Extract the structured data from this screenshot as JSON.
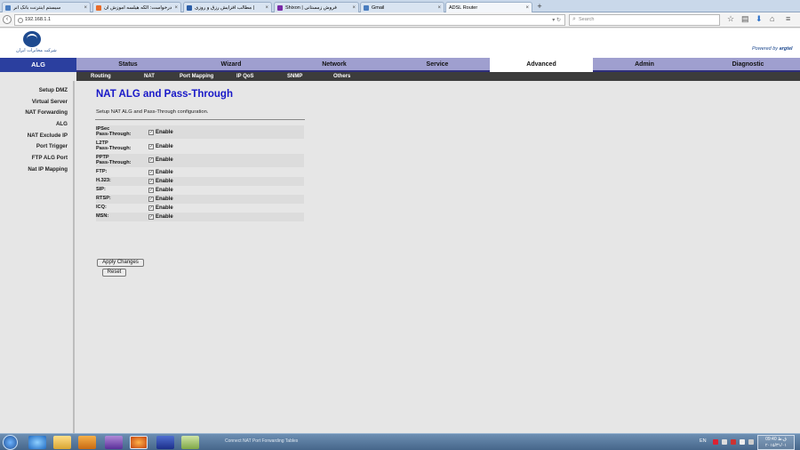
{
  "browser": {
    "tabs": [
      {
        "title": "سیستم اینترنت بانک آنر",
        "color": "#4a7dbf",
        "active": false
      },
      {
        "title": "درخواست: الکه هیلسه آموزش ان",
        "color": "#e86b2a",
        "active": false
      },
      {
        "title": "مطالب افزایش رزق و روزی |",
        "color": "#2b5ea8",
        "active": false
      },
      {
        "title": "Shixon | فروش زمستانی",
        "color": "#7a2aa8",
        "active": false
      },
      {
        "title": "Gmail",
        "color": "#4a7dbf",
        "active": false
      },
      {
        "title": "ADSL Router",
        "color": "#ffffff",
        "active": true
      }
    ],
    "new_tab": "+",
    "address": "192.168.1.1",
    "search_placeholder": "Search"
  },
  "router": {
    "logo_text": "شرکت مخابرات ایران",
    "powered_by": "Powered by",
    "powered_brand": "argtel",
    "section_header": "ALG",
    "main_menu": [
      {
        "label": "Status",
        "active": false
      },
      {
        "label": "Wizard",
        "active": false
      },
      {
        "label": "Network",
        "active": false
      },
      {
        "label": "Service",
        "active": false
      },
      {
        "label": "Advanced",
        "active": true
      },
      {
        "label": "Admin",
        "active": false
      },
      {
        "label": "Diagnostic",
        "active": false
      }
    ],
    "sub_menu": [
      "Routing",
      "NAT",
      "Port Mapping",
      "IP QoS",
      "SNMP",
      "Others"
    ],
    "sidebar": [
      "Setup DMZ",
      "Virtual Server",
      "NAT Forwarding",
      "ALG",
      "NAT Exclude IP",
      "Port Trigger",
      "FTP ALG Port",
      "Nat IP Mapping"
    ]
  },
  "content": {
    "title": "NAT ALG and Pass-Through",
    "description": "Setup NAT ALG and Pass-Through configuration.",
    "rows": [
      {
        "label_line1": "IPSec",
        "label_line2": "Pass-Through:",
        "checked": true,
        "enable_label": "Enable"
      },
      {
        "label_line1": "L2TP",
        "label_line2": "Pass-Through:",
        "checked": true,
        "enable_label": "Enable"
      },
      {
        "label_line1": "PPTP",
        "label_line2": "Pass-Through:",
        "checked": true,
        "enable_label": "Enable"
      },
      {
        "label_line1": "FTP:",
        "label_line2": "",
        "checked": true,
        "enable_label": "Enable"
      },
      {
        "label_line1": "H.323:",
        "label_line2": "",
        "checked": true,
        "enable_label": "Enable"
      },
      {
        "label_line1": "SIP:",
        "label_line2": "",
        "checked": true,
        "enable_label": "Enable"
      },
      {
        "label_line1": "RTSP:",
        "label_line2": "",
        "checked": true,
        "enable_label": "Enable"
      },
      {
        "label_line1": "ICQ:",
        "label_line2": "",
        "checked": true,
        "enable_label": "Enable"
      },
      {
        "label_line1": "MSN:",
        "label_line2": "",
        "checked": true,
        "enable_label": "Enable"
      }
    ],
    "apply_button": "Apply Changes",
    "reset_button": "Reset"
  },
  "taskbar": {
    "status_text": "Connect NAT Port Forwarding Tables",
    "language": "EN",
    "clock_time": "09:40 ق.ظ",
    "clock_date": "۲۰۱۵/۳۱/۰۱"
  },
  "colors": {
    "title_blue": "#1818c8",
    "menu_bar": "#9f9fcf",
    "section_header_bg": "#2b3f9f",
    "submenu_bg": "#3c3c3c"
  }
}
